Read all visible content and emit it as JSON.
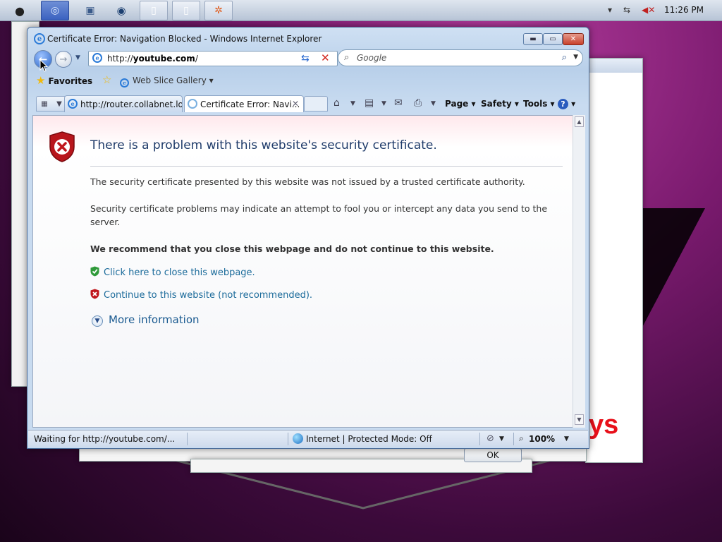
{
  "top_panel": {
    "clock": "11:26 PM",
    "launchers": [
      "apple-menu-icon",
      "browser-icon",
      "photos-icon",
      "media-icon",
      "document-icon",
      "document-icon",
      "ubuntu-icon"
    ]
  },
  "window": {
    "title": "Certificate Error: Navigation Blocked - Windows Internet Explorer",
    "controls": [
      "minimize",
      "maximize",
      "close"
    ]
  },
  "navbar": {
    "address_prefix": "http://",
    "address_domain": "youtube.com",
    "address_suffix": "/",
    "search_placeholder": "Google"
  },
  "favorites_bar": {
    "favorites_label": "Favorites",
    "web_slice_label": "Web Slice Gallery"
  },
  "tabs": [
    {
      "label": "http://router.collabnet.lo...",
      "active": false
    },
    {
      "label": "Certificate Error: Navi...",
      "active": true
    }
  ],
  "command_bar": {
    "page_label": "Page",
    "safety_label": "Safety",
    "tools_label": "Tools"
  },
  "content": {
    "heading": "There is a problem with this website's security certificate.",
    "para1": "The security certificate presented by this website was not issued by a trusted certificate authority.",
    "para2": "Security certificate problems may indicate an attempt to fool you or intercept any data you send to the server.",
    "recommendation": "We recommend that you close this webpage and do not continue to this website.",
    "close_link": "Click here to close this webpage.",
    "continue_link": "Continue to this website (not recommended).",
    "more_info": "More information"
  },
  "status_bar": {
    "status": "Waiting for http://youtube.com/...",
    "zone": "Internet | Protected Mode: Off",
    "zoom": "100%"
  },
  "background_dialog": {
    "ok_label": "OK",
    "partial_text": "ys"
  },
  "colors": {
    "accent_link": "#1a6a9a",
    "heading": "#1f3b6a",
    "error_red": "#c0161c",
    "safe_green": "#2f9a3a"
  }
}
